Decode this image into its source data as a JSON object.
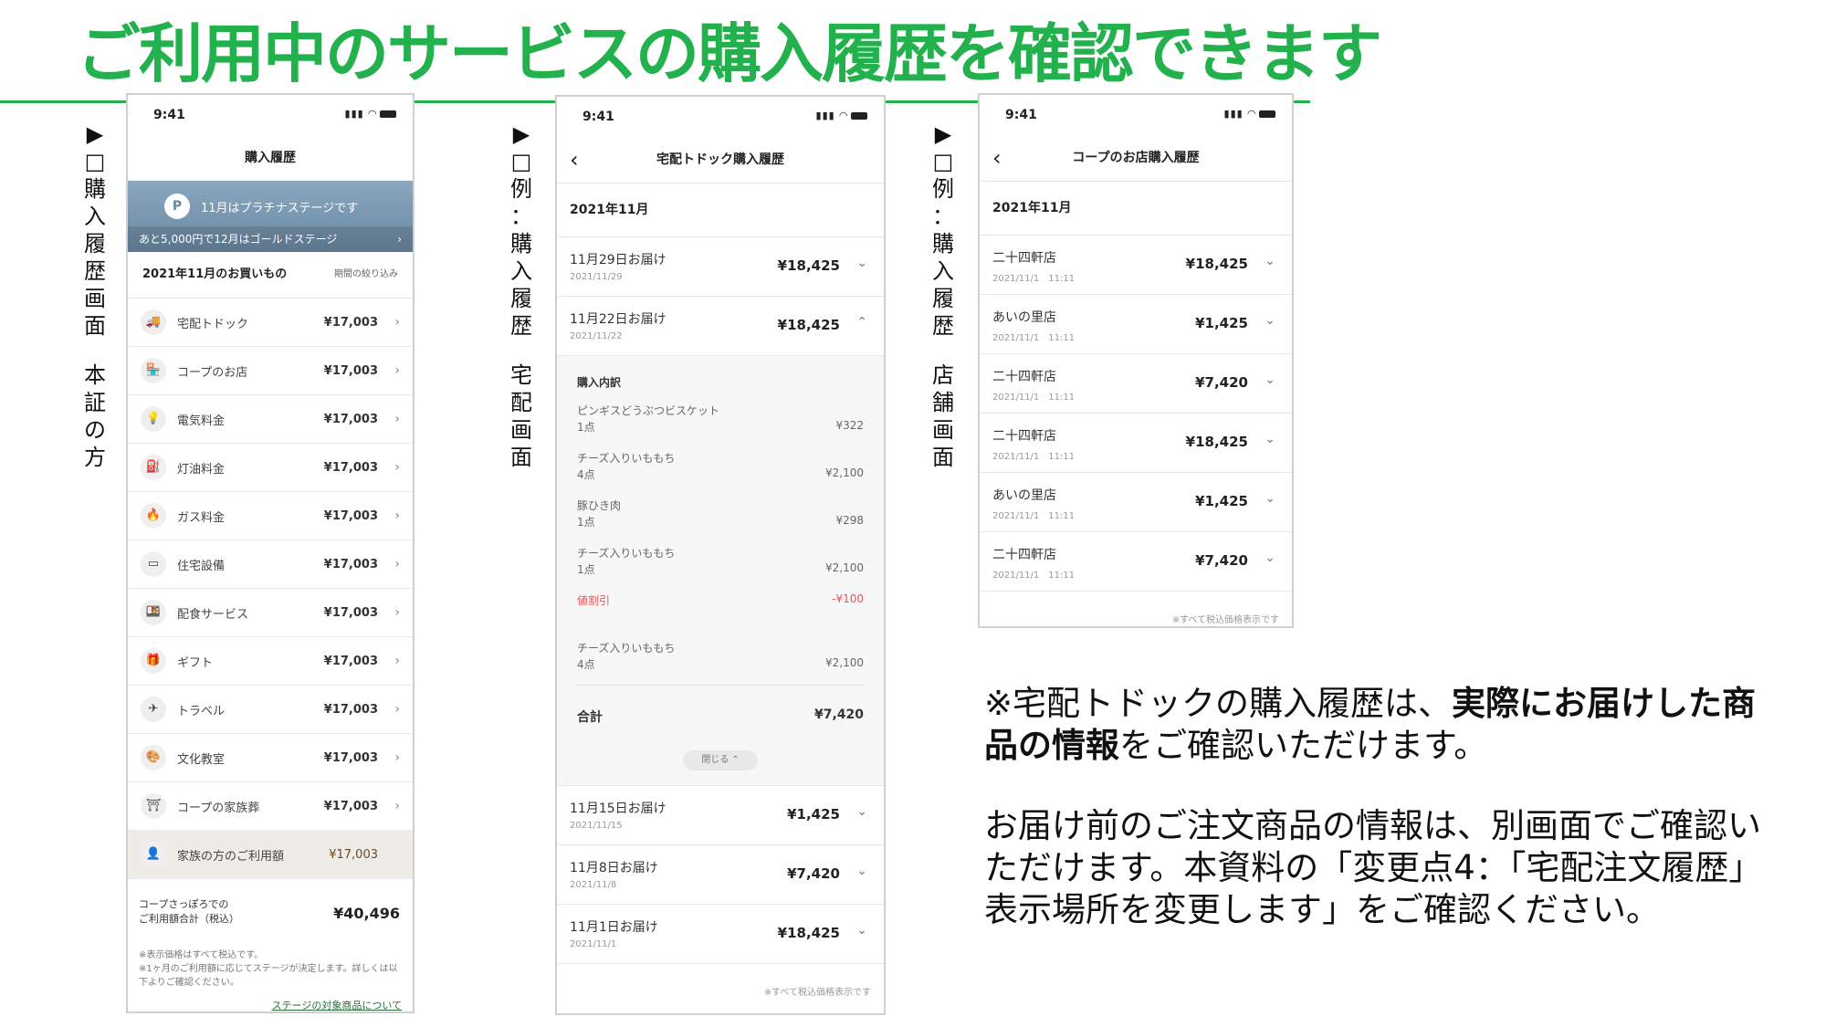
{
  "title": "ご利用中のサービスの購入履歴を確認できます",
  "labels": {
    "left": [
      "▶",
      "□",
      "購",
      "入",
      "履",
      "歴",
      "画",
      "面",
      "",
      "本",
      "証",
      "の",
      "方"
    ],
    "middle": [
      "▶",
      "□",
      "例",
      "：",
      "購",
      "入",
      "履",
      "歴",
      "",
      "宅",
      "配",
      "画",
      "面"
    ],
    "right": [
      "▶",
      "□",
      "例",
      "：",
      "購",
      "入",
      "履",
      "歴",
      "",
      "店",
      "舗",
      "画",
      "面"
    ]
  },
  "phone1": {
    "time": "9:41",
    "header": "購入履歴",
    "badge": "P",
    "stage_text": "11月はプラチナステージです",
    "stage_sub": "あと5,000円で12月はゴールドステージ",
    "section_title": "2021年11月のお買いもの",
    "filter": "期間の絞り込み",
    "categories": [
      {
        "icon": "🚚",
        "name": "宅配トドック",
        "amount": "¥17,003"
      },
      {
        "icon": "🏪",
        "name": "コープのお店",
        "amount": "¥17,003"
      },
      {
        "icon": "💡",
        "name": "電気料金",
        "amount": "¥17,003"
      },
      {
        "icon": "⛽",
        "name": "灯油料金",
        "amount": "¥17,003"
      },
      {
        "icon": "🔥",
        "name": "ガス料金",
        "amount": "¥17,003"
      },
      {
        "icon": "▭",
        "name": "住宅設備",
        "amount": "¥17,003"
      },
      {
        "icon": "🍱",
        "name": "配食サービス",
        "amount": "¥17,003"
      },
      {
        "icon": "🎁",
        "name": "ギフト",
        "amount": "¥17,003"
      },
      {
        "icon": "✈",
        "name": "トラベル",
        "amount": "¥17,003"
      },
      {
        "icon": "🎨",
        "name": "文化教室",
        "amount": "¥17,003"
      },
      {
        "icon": "⛩",
        "name": "コープの家族葬",
        "amount": "¥17,003"
      }
    ],
    "family": {
      "icon": "👤",
      "name": "家族の方のご利用額",
      "amount": "¥17,003"
    },
    "total_label_1": "コープさっぽろでの",
    "total_label_2": "ご利用額合計（税込）",
    "total_value": "¥40,496",
    "note1": "※表示価格はすべて税込です。",
    "note2": "※1ヶ月のご利用額に応じてステージが決定します。詳しくは以下よりご確認ください。",
    "link": "ステージの対象商品について"
  },
  "phone2": {
    "time": "9:41",
    "header": "宅配トドック購入履歴",
    "month": "2021年11月",
    "rows_top": [
      {
        "title": "11月29日お届け",
        "date": "2021/11/29",
        "amount": "¥18,425",
        "chev": "⌄"
      },
      {
        "title": "11月22日お届け",
        "date": "2021/11/22",
        "amount": "¥18,425",
        "chev": "⌃"
      }
    ],
    "detail_header": "購入内訳",
    "items": [
      {
        "name": "ピンギスどうぶつビスケット",
        "qty": "1点",
        "price": "¥322"
      },
      {
        "name": "チーズ入りいももち",
        "qty": "4点",
        "price": "¥2,100"
      },
      {
        "name": "豚ひき肉",
        "qty": "1点",
        "price": "¥298"
      },
      {
        "name": "チーズ入りいももち",
        "qty": "1点",
        "price": "¥2,100"
      }
    ],
    "discount": {
      "name": "値割引",
      "price": "-¥100"
    },
    "items2": [
      {
        "name": "チーズ入りいももち",
        "qty": "4点",
        "price": "¥2,100"
      }
    ],
    "sum_label": "合計",
    "sum_value": "¥7,420",
    "close_label": "閉じる ⌃",
    "rows_bottom": [
      {
        "title": "11月15日お届け",
        "date": "2021/11/15",
        "amount": "¥1,425",
        "chev": "⌄"
      },
      {
        "title": "11月8日お届け",
        "date": "2021/11/8",
        "amount": "¥7,420",
        "chev": "⌄"
      },
      {
        "title": "11月1日お届け",
        "date": "2021/11/1",
        "amount": "¥18,425",
        "chev": "⌄"
      }
    ],
    "footer": "※すべて税込価格表示です"
  },
  "phone3": {
    "time": "9:41",
    "header": "コープのお店購入履歴",
    "month": "2021年11月",
    "rows": [
      {
        "title": "二十四軒店",
        "date": "2021/11/1　11:11",
        "amount": "¥18,425",
        "chev": "⌄"
      },
      {
        "title": "あいの里店",
        "date": "2021/11/1　11:11",
        "amount": "¥1,425",
        "chev": "⌄"
      },
      {
        "title": "二十四軒店",
        "date": "2021/11/1　11:11",
        "amount": "¥7,420",
        "chev": "⌄"
      },
      {
        "title": "二十四軒店",
        "date": "2021/11/1　11:11",
        "amount": "¥18,425",
        "chev": "⌄"
      },
      {
        "title": "あいの里店",
        "date": "2021/11/1　11:11",
        "amount": "¥1,425",
        "chev": "⌄"
      },
      {
        "title": "二十四軒店",
        "date": "2021/11/1　11:11",
        "amount": "¥7,420",
        "chev": "⌄"
      }
    ],
    "footer": "※すべて税込価格表示です"
  },
  "note1": {
    "a": "※宅配トドックの購入履歴は、",
    "b": "実際にお届けした商品の情報",
    "c": "をご確認いただけます。"
  },
  "note2": "お届け前のご注文商品の情報は、別画面でご確認いただけます。本資料の「変更点4：「宅配注文履歴」表示場所を変更します」をご確認ください。"
}
